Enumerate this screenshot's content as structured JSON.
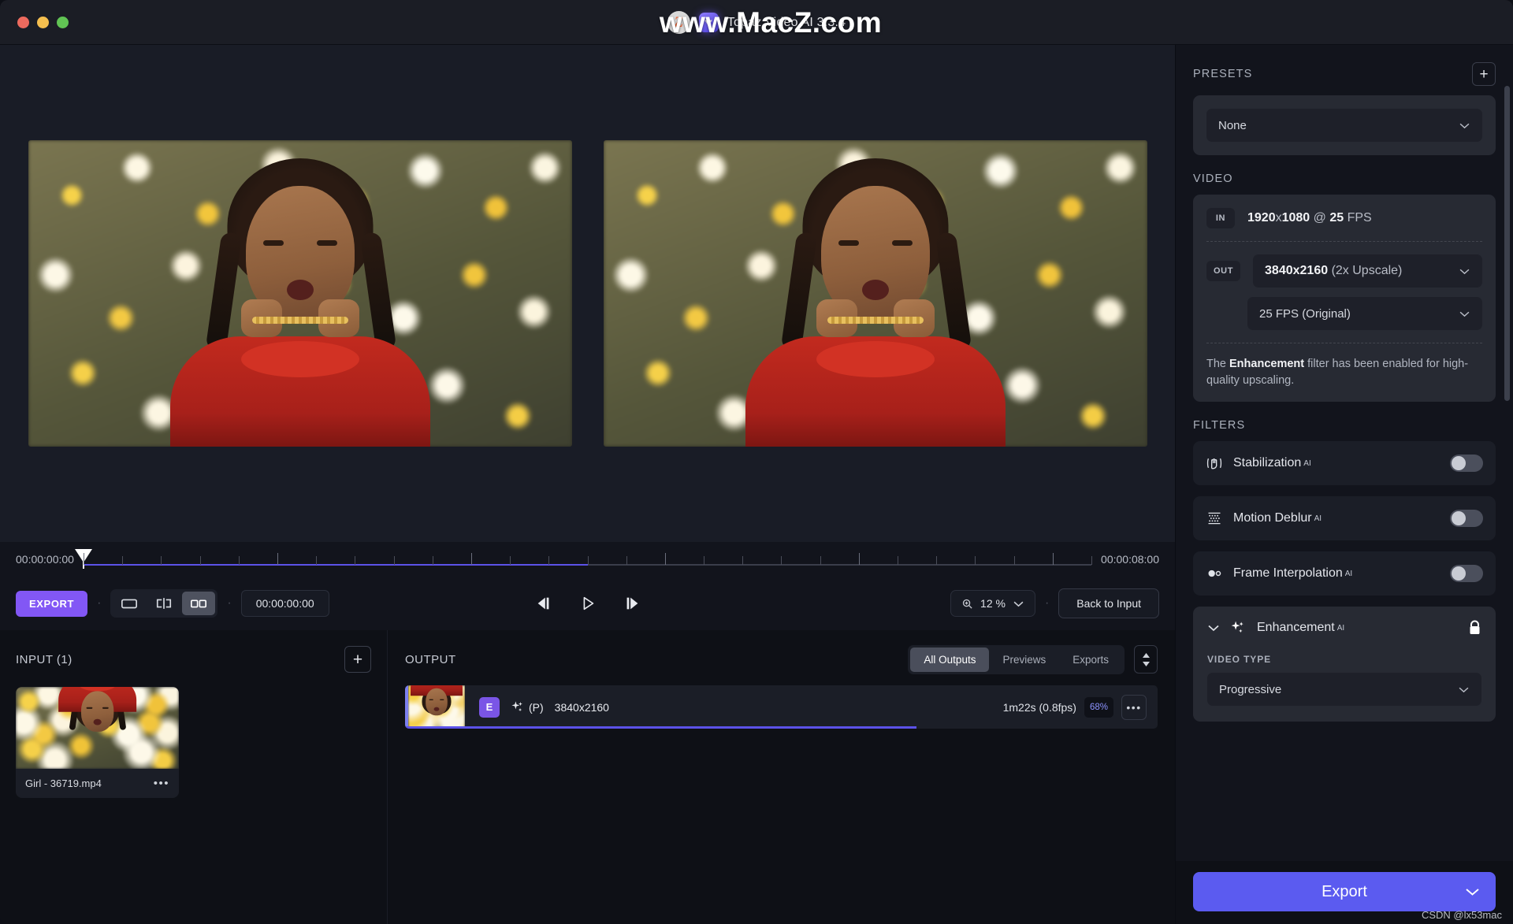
{
  "window": {
    "title": "Topaz Video AI 3.3.4",
    "watermark_top": "www.MacZ.com",
    "watermark_bottom": "CSDN @lx53mac",
    "logo_letter": "Z"
  },
  "timeline": {
    "start_timecode": "00:00:00:00",
    "end_timecode": "00:00:08:00",
    "playhead_percent": 0,
    "fill_percent": 50
  },
  "toolbar": {
    "export_label": "EXPORT",
    "current_timecode": "00:00:00:00",
    "view_single": "single-view-icon",
    "view_split": "split-view-icon",
    "view_side_by_side": "side-by-side-view-icon",
    "prev_frame": "previous-frame-icon",
    "play": "play-icon",
    "next_frame": "next-frame-icon",
    "zoom_value": "12 %",
    "back_to_input": "Back to Input"
  },
  "input_panel": {
    "title": "INPUT (1)",
    "add_label": "+",
    "items": [
      {
        "name": "Girl - 36719.mp4",
        "more": "•••"
      }
    ]
  },
  "output_panel": {
    "title": "OUTPUT",
    "tabs": [
      {
        "label": "All Outputs",
        "active": true
      },
      {
        "label": "Previews",
        "active": false
      },
      {
        "label": "Exports",
        "active": false
      }
    ],
    "rows": [
      {
        "badge": "E",
        "mode": "(P)",
        "resolution": "3840x2160",
        "eta": "1m22s (0.8fps)",
        "percent": "68%",
        "progress": 68,
        "more": "•••"
      }
    ]
  },
  "sidebar": {
    "presets": {
      "label": "PRESETS",
      "add_label": "+",
      "selected": "None"
    },
    "video": {
      "label": "VIDEO",
      "in_tag": "IN",
      "in_width": "1920",
      "in_x": "x",
      "in_height": "1080",
      "in_at": " @ ",
      "in_fps": "25",
      "in_fps_unit": " FPS",
      "out_tag": "OUT",
      "out_resolution_bold": "3840x2160",
      "out_resolution_note": " (2x Upscale)",
      "out_fps": "25 FPS (Original)",
      "note_prefix": "The ",
      "note_bold": "Enhancement",
      "note_suffix": " filter has been enabled for high-quality upscaling."
    },
    "filters": {
      "label": "FILTERS",
      "items": [
        {
          "name": "Stabilization",
          "ai": "AI",
          "icon": "stabilization-icon",
          "enabled": false
        },
        {
          "name": "Motion Deblur",
          "ai": "AI",
          "icon": "motion-deblur-icon",
          "enabled": false
        },
        {
          "name": "Frame Interpolation",
          "ai": "AI",
          "icon": "frame-interpolation-icon",
          "enabled": false
        }
      ],
      "enhancement": {
        "name": "Enhancement",
        "ai": "AI",
        "icon": "sparkle-icon",
        "locked": true,
        "video_type_label": "VIDEO TYPE",
        "video_type_value": "Progressive"
      }
    },
    "export": {
      "label": "Export"
    }
  },
  "colors": {
    "accent_purple": "#8257f5",
    "export_blue": "#5b5bf0",
    "progress": "#5c52e8",
    "badge_e": "#7a55e6"
  }
}
